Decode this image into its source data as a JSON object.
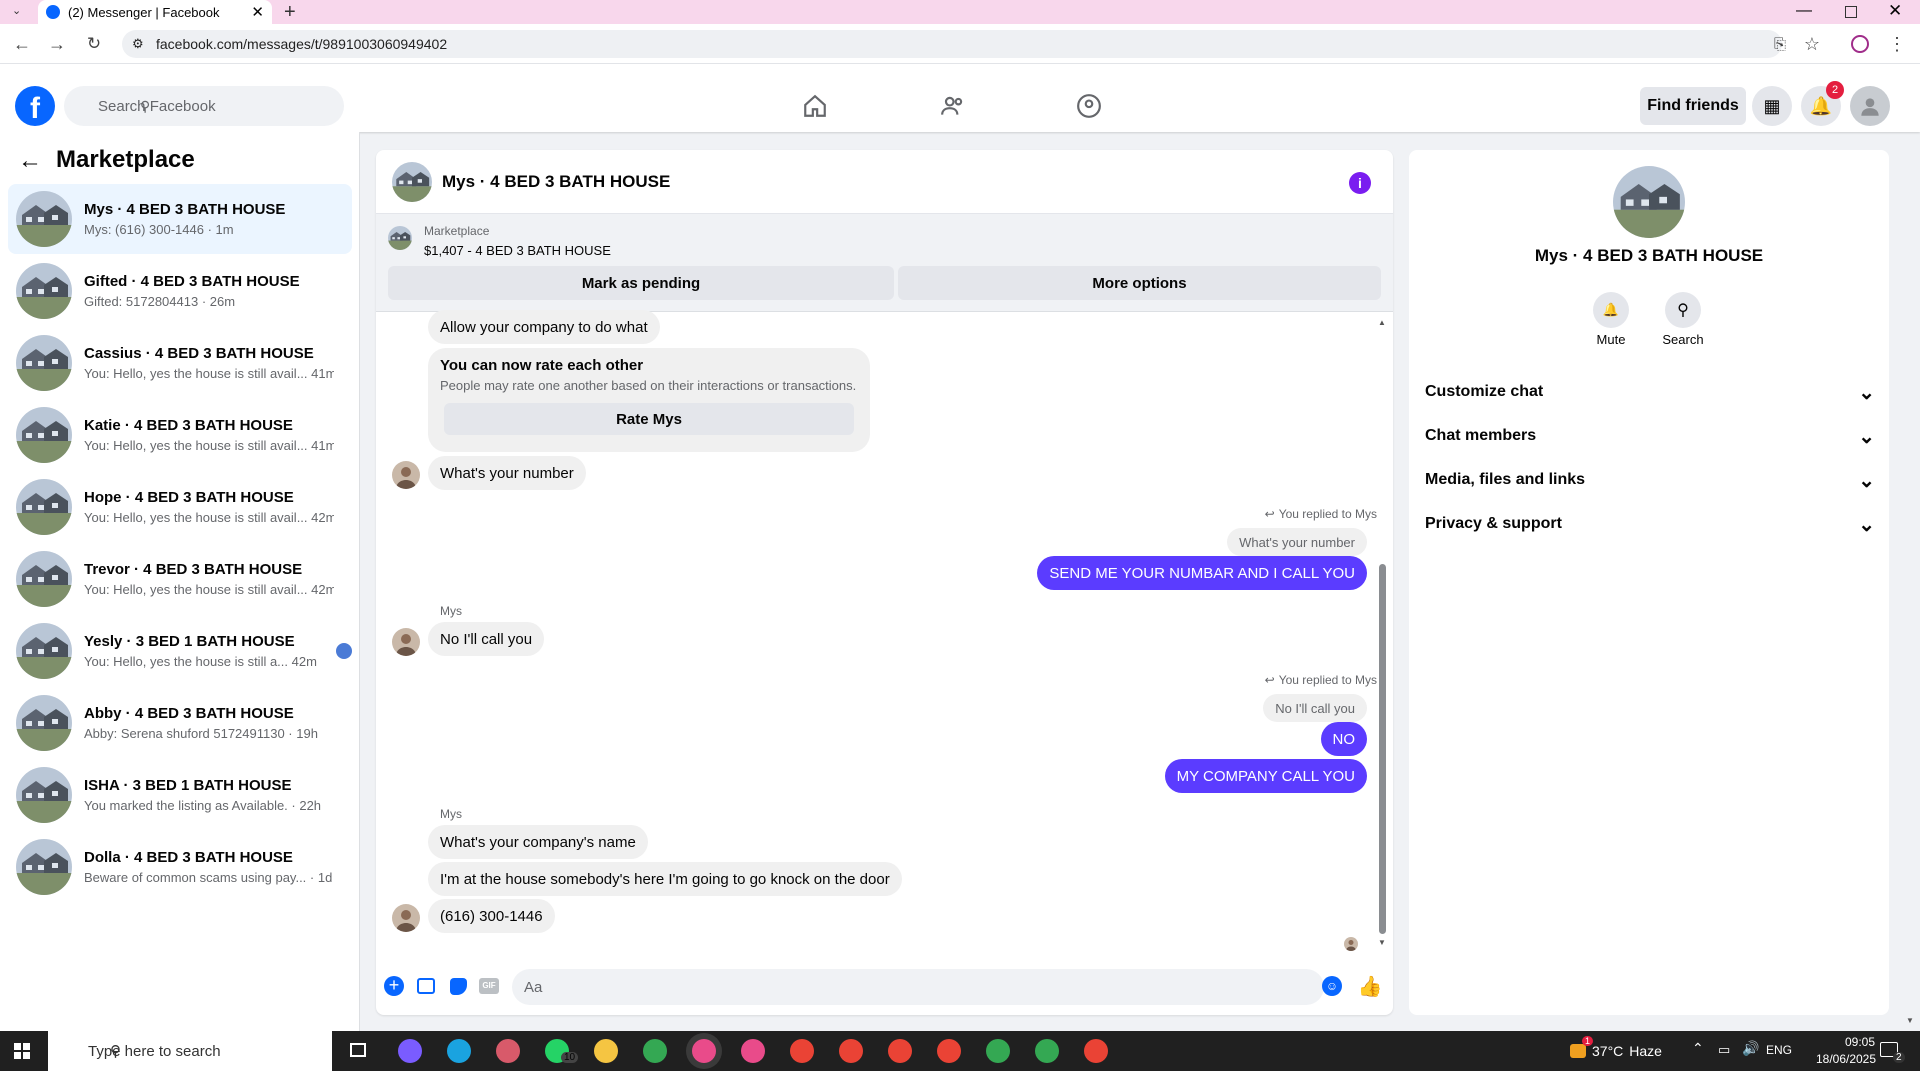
{
  "browser": {
    "tab_title": "(2) Messenger | Facebook",
    "url": "facebook.com/messages/t/9891003060949402"
  },
  "header": {
    "search_placeholder": "Search Facebook",
    "find_friends": "Find friends",
    "notification_count": "2"
  },
  "sidebar": {
    "title": "Marketplace",
    "conversations": [
      {
        "name": "Mys · 4 BED 3 BATH HOUSE",
        "preview": "Mys: (616) 300-1446 · 1m"
      },
      {
        "name": "Gifted · 4 BED 3 BATH HOUSE",
        "preview": "Gifted: 5172804413 · 26m"
      },
      {
        "name": "Cassius · 4 BED 3 BATH HOUSE",
        "preview": "You: Hello, yes the house is still avail...",
        "time": "41m"
      },
      {
        "name": "Katie · 4 BED 3 BATH HOUSE",
        "preview": "You: Hello, yes the house is still avail...",
        "time": "41m"
      },
      {
        "name": "Hope · 4 BED 3 BATH HOUSE",
        "preview": "You: Hello, yes the house is still avail...",
        "time": "42m"
      },
      {
        "name": "Trevor · 4 BED 3 BATH HOUSE",
        "preview": "You: Hello, yes the house is still avail...",
        "time": "42m"
      },
      {
        "name": "Yesly · 3 BED 1 BATH HOUSE",
        "preview": "You: Hello, yes the house is still a...",
        "time": "42m"
      },
      {
        "name": "Abby · 4 BED 3 BATH HOUSE",
        "preview": "Abby: Serena shuford 5172491130 · 19h"
      },
      {
        "name": "ISHA · 3 BED 1 BATH HOUSE",
        "preview": "You marked the listing as Available. · 22h"
      },
      {
        "name": "Dolla · 4 BED 3 BATH HOUSE",
        "preview": "Beware of common scams using pay... · 1d"
      }
    ]
  },
  "chat": {
    "title": "Mys · 4 BED 3 BATH HOUSE",
    "listing_source": "Marketplace",
    "listing_price_title": "$1,407 - 4 BED 3 BATH HOUSE",
    "mark_pending": "Mark as pending",
    "more_options": "More options",
    "rate_card": {
      "title": "You can now rate each other",
      "desc": "People may rate one another based on their interactions or transactions.",
      "button": "Rate Mys"
    },
    "messages": {
      "m1": "Allow your company to do what",
      "m2": "What's your number",
      "reply_label1": "You replied to Mys",
      "quote1": "What's your number",
      "m3": "SEND ME YOUR NUMBAR AND I CALL YOU",
      "sender1": "Mys",
      "m4": "No I'll call you",
      "reply_label2": "You replied to Mys",
      "quote2": "No I'll call you",
      "m5": "NO",
      "m6": "MY COMPANY CALL YOU",
      "sender2": "Mys",
      "m7": "What's your company's name",
      "m8": "I'm at the house somebody's here I'm going to go knock on the door",
      "m9": "(616) 300-1446"
    },
    "composer_placeholder": "Aa"
  },
  "right_panel": {
    "title": "Mys · 4 BED 3 BATH HOUSE",
    "mute": "Mute",
    "search": "Search",
    "sections": [
      "Customize chat",
      "Chat members",
      "Media, files and links",
      "Privacy & support"
    ]
  },
  "taskbar": {
    "search_placeholder": "Type here to search",
    "weather_temp": "37°C",
    "weather_desc": "Haze",
    "weather_badge": "1",
    "whatsapp_badge": "10",
    "lang": "ENG",
    "time": "09:05",
    "date": "18/06/2025",
    "notif_count": "2"
  },
  "colors": {
    "accent": "#0866ff",
    "bubble_me": "#5b3cff",
    "notif": "#e41e3f"
  }
}
